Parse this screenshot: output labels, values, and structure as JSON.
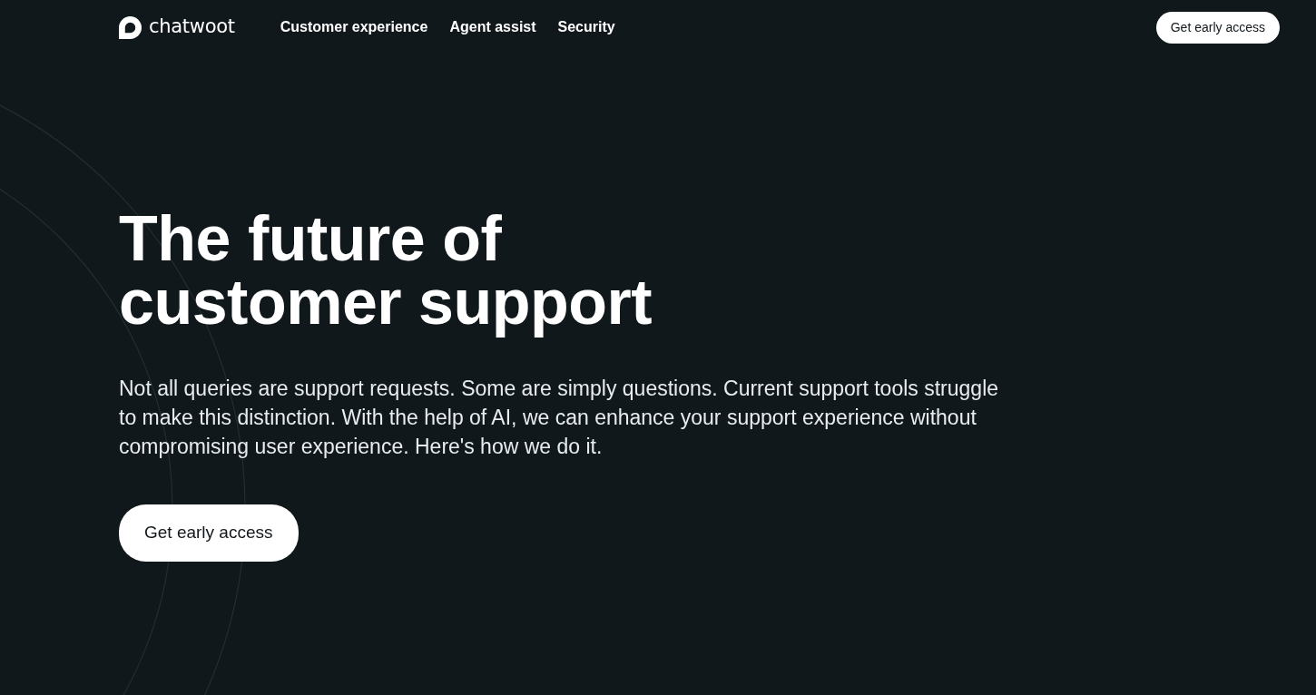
{
  "header": {
    "brand": "chatwoot",
    "nav": [
      {
        "label": "Customer experience"
      },
      {
        "label": "Agent assist"
      },
      {
        "label": "Security"
      }
    ],
    "cta": "Get early access"
  },
  "hero": {
    "title_lines": [
      "The future of",
      "customer support"
    ],
    "description": "Not all queries are support requests. Some are simply questions. Current support tools struggle to make this distinction. With the help of AI, we can enhance your support experience without compromising user experience. Here's how we do it.",
    "cta": "Get early access"
  }
}
